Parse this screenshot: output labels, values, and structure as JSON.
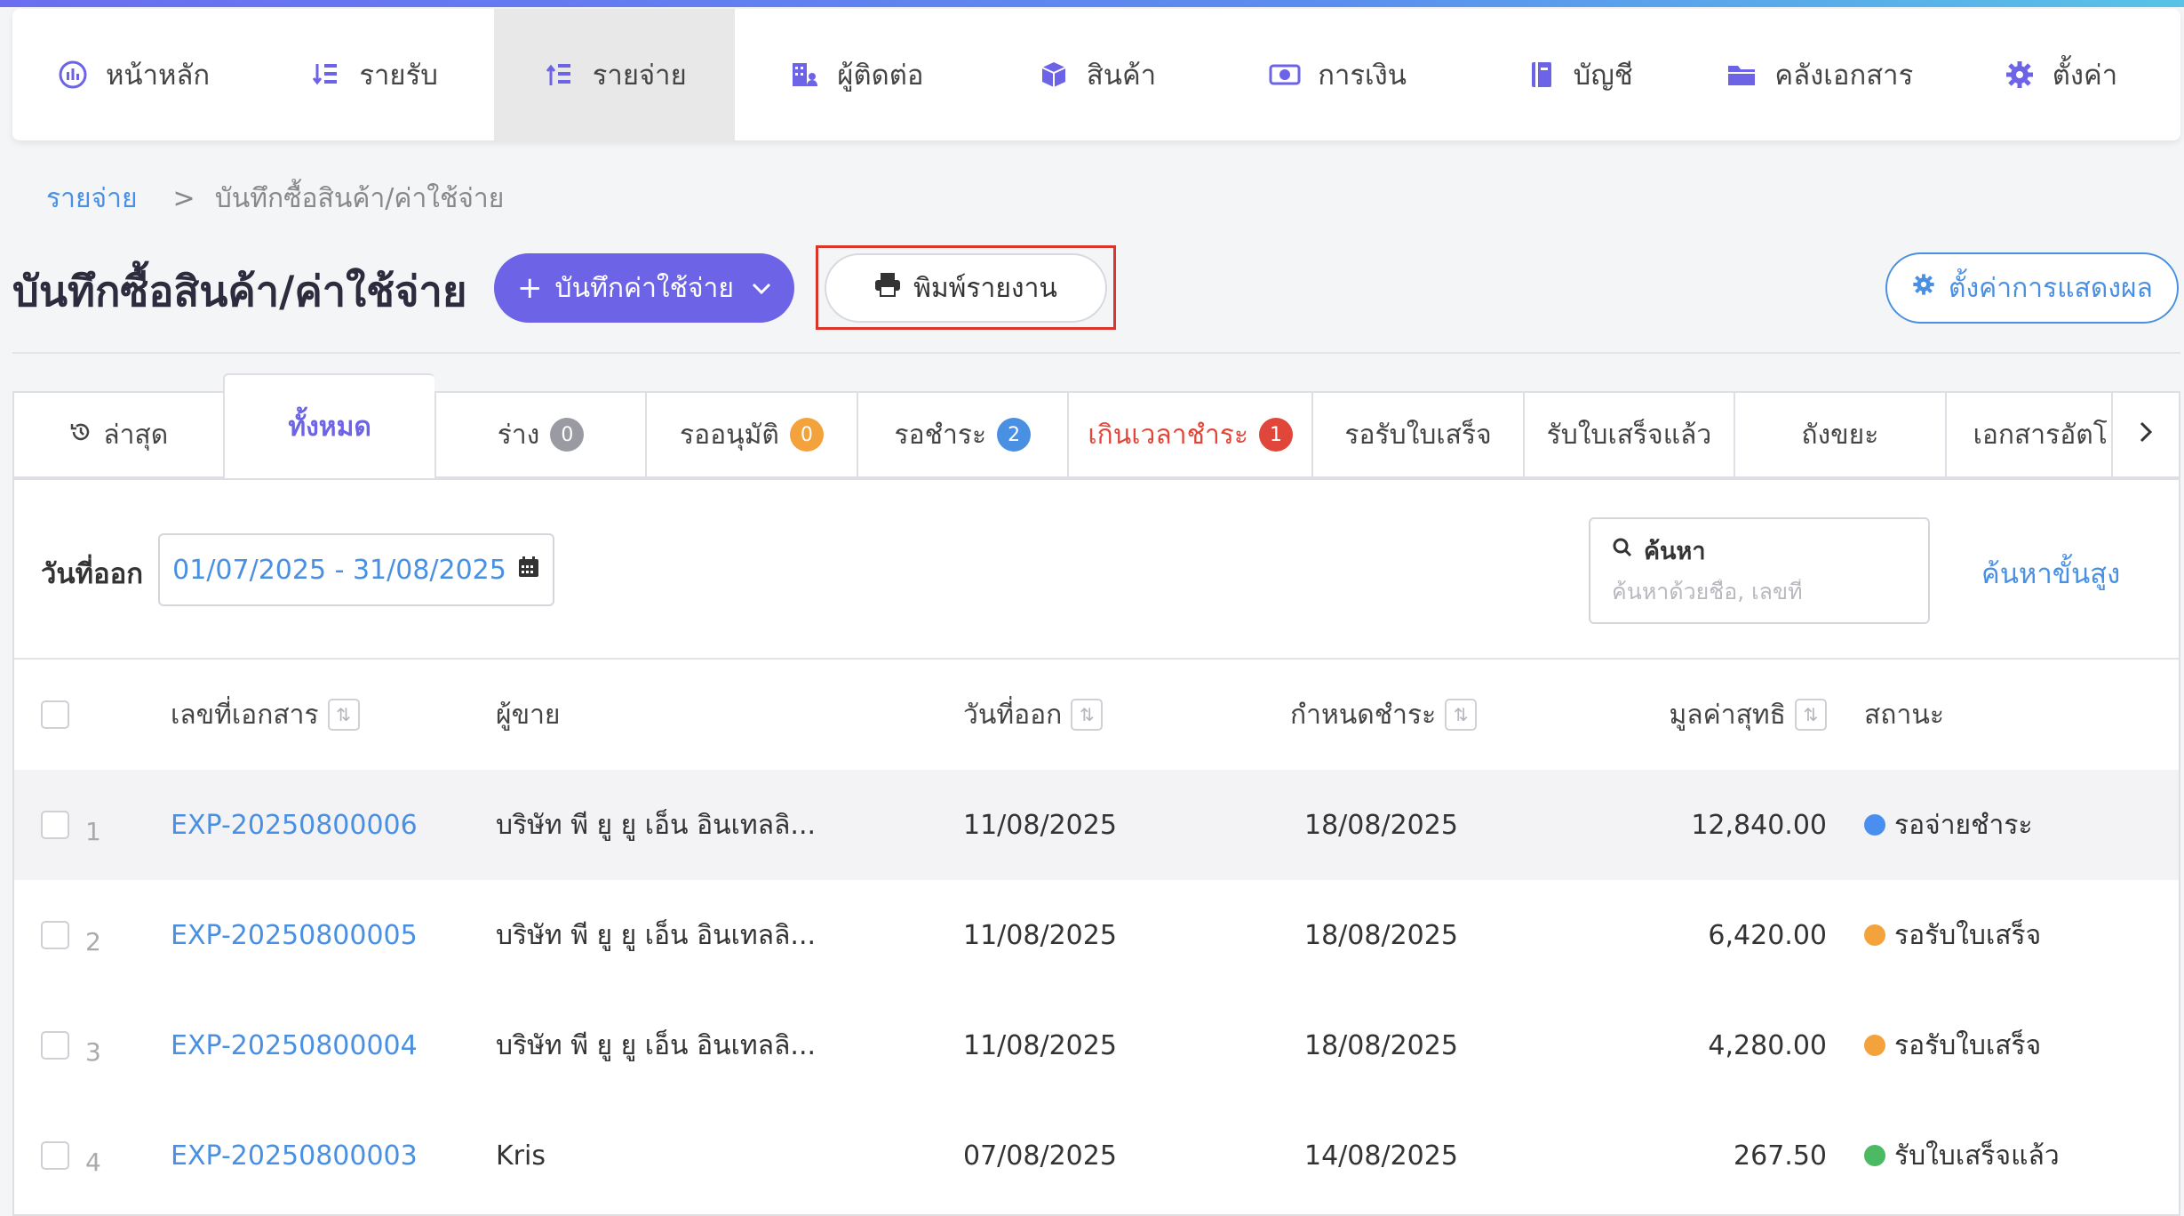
{
  "colors": {
    "accent": "#6c63e6",
    "link": "#4a90e2",
    "danger": "#e0473a",
    "highlight": "#d9352b"
  },
  "nav": {
    "items": [
      {
        "label": "หน้าหลัก",
        "icon": "dashboard-gauge-icon"
      },
      {
        "label": "รายรับ",
        "icon": "income-list-icon"
      },
      {
        "label": "รายจ่าย",
        "icon": "expense-list-icon"
      },
      {
        "label": "ผู้ติดต่อ",
        "icon": "contacts-building-icon"
      },
      {
        "label": "สินค้า",
        "icon": "product-box-icon"
      },
      {
        "label": "การเงิน",
        "icon": "money-bill-icon"
      },
      {
        "label": "บัญชี",
        "icon": "accounting-book-icon"
      },
      {
        "label": "คลังเอกสาร",
        "icon": "folder-icon"
      },
      {
        "label": "ตั้งค่า",
        "icon": "gear-icon"
      }
    ]
  },
  "breadcrumb": {
    "parent": "รายจ่าย",
    "separator": ">",
    "current": "บันทึกซื้อสินค้า/ค่าใช้จ่าย"
  },
  "page": {
    "title": "บันทึกซื้อสินค้า/ค่าใช้จ่าย",
    "add_button": "บันทึกค่าใช้จ่าย",
    "print_button": "พิมพ์รายงาน",
    "settings_button": "ตั้งค่าการแสดงผล"
  },
  "tabs": [
    {
      "label": "ล่าสุด"
    },
    {
      "label": "ทั้งหมด"
    },
    {
      "label": "ร่าง",
      "count": "0"
    },
    {
      "label": "รออนุมัติ",
      "count": "0"
    },
    {
      "label": "รอชำระ",
      "count": "2"
    },
    {
      "label": "เกินเวลาชำระ",
      "count": "1"
    },
    {
      "label": "รอรับใบเสร็จ"
    },
    {
      "label": "รับใบเสร็จแล้ว"
    },
    {
      "label": "ถังขยะ"
    },
    {
      "label": "เอกสารอัตโนมัติ"
    }
  ],
  "filter": {
    "date_label": "วันที่ออก",
    "date_range": "01/07/2025 - 31/08/2025",
    "search_label": "ค้นหา",
    "search_placeholder": "ค้นหาด้วยชื่อ, เลขที่",
    "advanced_search": "ค้นหาขั้นสูง"
  },
  "table": {
    "columns": [
      "เลขที่เอกสาร",
      "ผู้ขาย",
      "วันที่ออก",
      "กำหนดชำระ",
      "มูลค่าสุทธิ",
      "สถานะ"
    ],
    "rows": [
      {
        "index": "1",
        "doc_no": "EXP-20250800006",
        "vendor": "บริษัท พี ยู ยู เอ็น อินเทลลิ...",
        "issue_date": "11/08/2025",
        "due_date": "18/08/2025",
        "amount": "12,840.00",
        "status": "รอจ่ายชำระ",
        "status_color": "#4a8ff0"
      },
      {
        "index": "2",
        "doc_no": "EXP-20250800005",
        "vendor": "บริษัท พี ยู ยู เอ็น อินเทลลิ...",
        "issue_date": "11/08/2025",
        "due_date": "18/08/2025",
        "amount": "6,420.00",
        "status": "รอรับใบเสร็จ",
        "status_color": "#f4a23c"
      },
      {
        "index": "3",
        "doc_no": "EXP-20250800004",
        "vendor": "บริษัท พี ยู ยู เอ็น อินเทลลิ...",
        "issue_date": "11/08/2025",
        "due_date": "18/08/2025",
        "amount": "4,280.00",
        "status": "รอรับใบเสร็จ",
        "status_color": "#f4a23c"
      },
      {
        "index": "4",
        "doc_no": "EXP-20250800003",
        "vendor": "Kris",
        "issue_date": "07/08/2025",
        "due_date": "14/08/2025",
        "amount": "267.50",
        "status": "รับใบเสร็จแล้ว",
        "status_color": "#4cb963"
      }
    ]
  }
}
